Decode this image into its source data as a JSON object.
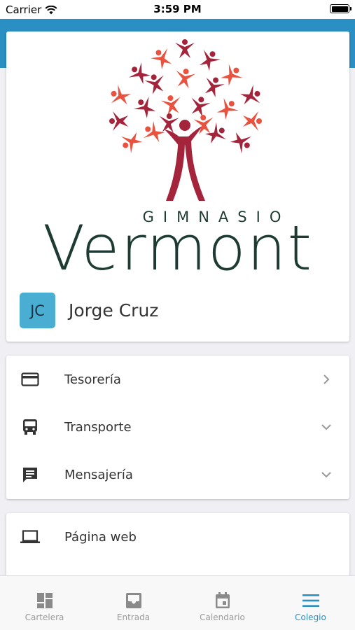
{
  "status_bar": {
    "carrier": "Carrier",
    "time": "3:59 PM"
  },
  "logo": {
    "line1": "GIMNASIO",
    "line2": "Vermont"
  },
  "profile": {
    "initials": "JC",
    "name": "Jorge Cruz"
  },
  "menu": [
    {
      "label": "Tesorería",
      "icon": "credit-card-icon",
      "chevron": "chevron-right"
    },
    {
      "label": "Transporte",
      "icon": "bus-icon",
      "chevron": "chevron-down"
    },
    {
      "label": "Mensajería",
      "icon": "message-icon",
      "chevron": "chevron-down"
    }
  ],
  "web": {
    "label": "Página web",
    "icon": "laptop-icon"
  },
  "tabs": [
    {
      "label": "Cartelera",
      "icon": "dashboard-icon",
      "active": false
    },
    {
      "label": "Entrada",
      "icon": "inbox-icon",
      "active": false
    },
    {
      "label": "Calendario",
      "icon": "calendar-icon",
      "active": false
    },
    {
      "label": "Colegio",
      "icon": "menu-icon",
      "active": true
    }
  ],
  "colors": {
    "accent": "#2a8fc2",
    "avatar_bg": "#4aaed3",
    "logo_text": "#1e3b33",
    "logo_red_dark": "#a4243b",
    "logo_red_light": "#e8523f"
  }
}
